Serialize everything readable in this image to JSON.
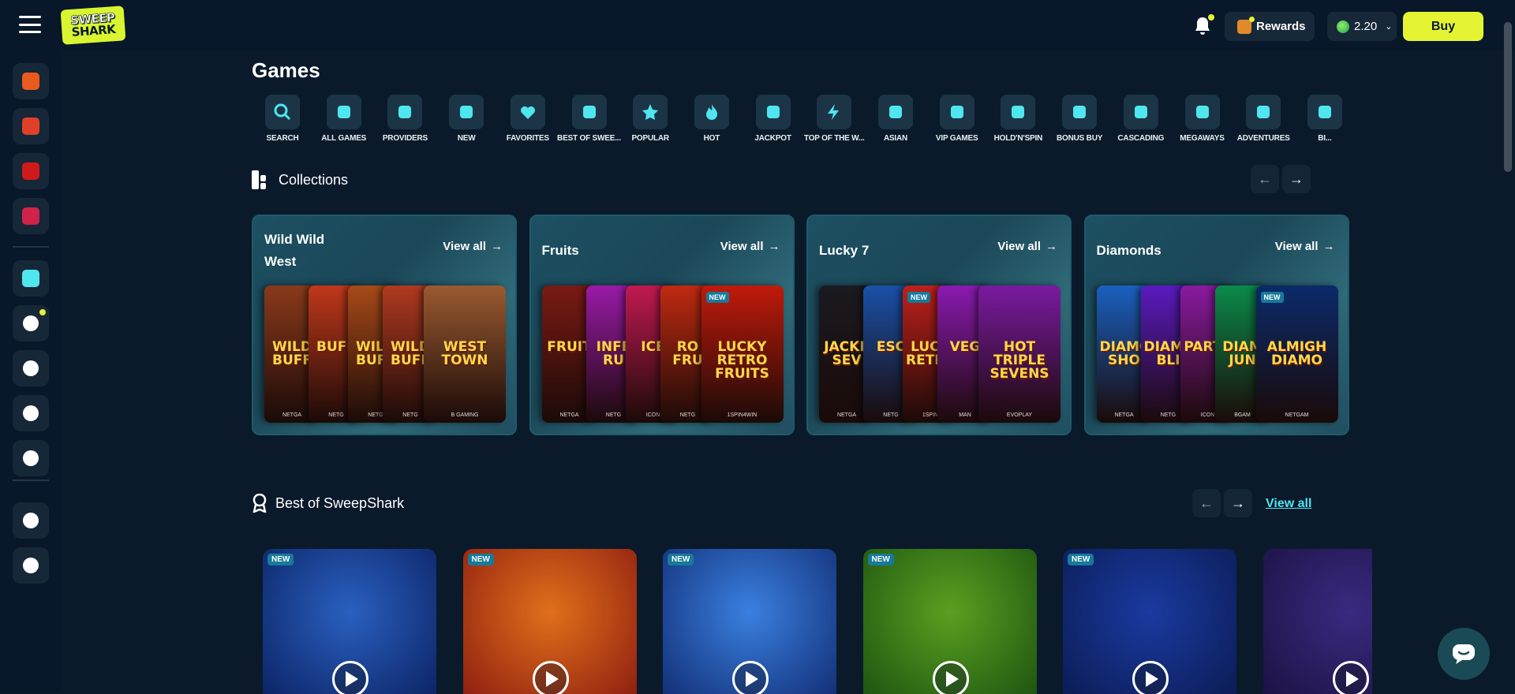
{
  "header": {
    "brand_line1": "SWEEP",
    "brand_line2": "SHARK",
    "rewards_label": "Rewards",
    "balance": "2.20",
    "buy_label": "Buy"
  },
  "page_title": "Games",
  "categories": [
    {
      "label": "SEARCH",
      "icon": "search-icon"
    },
    {
      "label": "ALL GAMES",
      "icon": "cherries-icon"
    },
    {
      "label": "PROVIDERS",
      "icon": "dice-icon"
    },
    {
      "label": "NEW",
      "icon": "new-icon"
    },
    {
      "label": "FAVORITES",
      "icon": "heart-icon"
    },
    {
      "label": "BEST OF SWEE...",
      "icon": "award-icon"
    },
    {
      "label": "POPULAR",
      "icon": "star-icon"
    },
    {
      "label": "HOT",
      "icon": "flame-icon"
    },
    {
      "label": "JACKPOT",
      "icon": "slot-machine-icon"
    },
    {
      "label": "TOP OF THE W...",
      "icon": "lightning-icon"
    },
    {
      "label": "ASIAN",
      "icon": "lotus-icon"
    },
    {
      "label": "VIP GAMES",
      "icon": "vip-icon"
    },
    {
      "label": "HOLD'N'SPIN",
      "icon": "coins-icon"
    },
    {
      "label": "BONUS BUY",
      "icon": "gift-icon"
    },
    {
      "label": "CASCADING",
      "icon": "cascade-icon"
    },
    {
      "label": "MEGAWAYS",
      "icon": "megaways-icon"
    },
    {
      "label": "ADVENTURES",
      "icon": "compass-icon"
    },
    {
      "label": "BI...",
      "icon": "more-icon"
    }
  ],
  "collections_section": {
    "title": "Collections"
  },
  "collections": [
    {
      "title": "Wild Wild West",
      "view_all": "View all",
      "tiles": [
        {
          "text": "WILD BUFF",
          "provider": "NETGA",
          "color": "#8a3a1a",
          "new": false
        },
        {
          "text": "BUFF",
          "provider": "NETG",
          "color": "#c0381a",
          "new": false
        },
        {
          "text": "WILD BUFF",
          "provider": "NETG",
          "color": "#a84a18",
          "new": false
        },
        {
          "text": "WILD BUFF",
          "provider": "NETG",
          "color": "#b03a20",
          "new": false
        },
        {
          "text": "WEST TOWN",
          "provider": "B GAMING",
          "color": "#9a5a30",
          "new": false
        }
      ]
    },
    {
      "title": "Fruits",
      "view_all": "View all",
      "tiles": [
        {
          "text": "FRUIT",
          "provider": "NETGA",
          "color": "#7a1a14",
          "new": false
        },
        {
          "text": "INFE RU",
          "provider": "NETG",
          "color": "#9a1aa8",
          "new": false
        },
        {
          "text": "ICE",
          "provider": "ICON",
          "color": "#c01a50",
          "new": false
        },
        {
          "text": "RO FRU",
          "provider": "NETG",
          "color": "#c02a10",
          "new": false
        },
        {
          "text": "LUCKY RETRO FRUITS",
          "provider": "1SPIN4WIN",
          "color": "#c01a0a",
          "new": true
        }
      ]
    },
    {
      "title": "Lucky 7",
      "view_all": "View all",
      "tiles": [
        {
          "text": "JACKP SEV",
          "provider": "NETGA",
          "color": "#1a1a20",
          "new": false
        },
        {
          "text": "ESC",
          "provider": "NETG",
          "color": "#1a50a8",
          "new": false
        },
        {
          "text": "LUCK RETRO",
          "provider": "1SPIN",
          "color": "#c0201a",
          "new": true
        },
        {
          "text": "VEG",
          "provider": "MAN",
          "color": "#8a1ab0",
          "new": false
        },
        {
          "text": "HOT TRIPLE SEVENS",
          "provider": "EVOPLAY",
          "color": "#7a1aa0",
          "new": false
        }
      ]
    },
    {
      "title": "Diamonds",
      "view_all": "View all",
      "tiles": [
        {
          "text": "DIAMO SHO",
          "provider": "NETGA",
          "color": "#1a60c0",
          "new": false
        },
        {
          "text": "DIAMON BLI",
          "provider": "NETG",
          "color": "#5a1ac0",
          "new": false
        },
        {
          "text": "PARTY",
          "provider": "ICON",
          "color": "#8a1aa0",
          "new": false
        },
        {
          "text": "DIAM JUN",
          "provider": "BGAM",
          "color": "#0a8a4a",
          "new": false
        },
        {
          "text": "ALMIGH DIAMO",
          "provider": "NETGAM",
          "color": "#0a2a6a",
          "new": true
        }
      ]
    }
  ],
  "best_section": {
    "title": "Best of SweepShark",
    "view_all": "View all"
  },
  "best_games": [
    {
      "name": "jockey-game",
      "new": true,
      "color1": "#2a60c0",
      "color2": "#0a2060"
    },
    {
      "name": "888-game",
      "new": true,
      "color1": "#e0701a",
      "color2": "#8a1a10"
    },
    {
      "name": "diamond-game",
      "new": true,
      "color1": "#3a80e0",
      "color2": "#102a70"
    },
    {
      "name": "lizard-game",
      "new": true,
      "color1": "#5aa020",
      "color2": "#1a5010"
    },
    {
      "name": "buffalo-game",
      "new": true,
      "color1": "#1a3aa0",
      "color2": "#0a1a50"
    },
    {
      "name": "partial-game",
      "new": false,
      "color1": "#3a2a80",
      "color2": "#1a1040"
    }
  ],
  "sidebar": [
    {
      "name": "daily-reward-icon",
      "color": "#e85a20"
    },
    {
      "name": "chest-icon",
      "color": "#e0402a"
    },
    {
      "name": "coupon-icon",
      "color": "#d01a1a"
    },
    {
      "name": "fp-badge-icon",
      "color": "#d0224a"
    },
    {
      "name": "games-cherries-icon",
      "color": "#4fe6f0"
    },
    {
      "name": "promotions-megaphone-icon",
      "color": "#ffffff"
    },
    {
      "name": "refer-friend-icon",
      "color": "#ffffff"
    },
    {
      "name": "help-icon",
      "color": "#ffffff"
    },
    {
      "name": "vip-crown-icon",
      "color": "#ffffff"
    },
    {
      "name": "support-headset-icon",
      "color": "#ffffff"
    },
    {
      "name": "logout-icon",
      "color": "#ffffff"
    }
  ]
}
